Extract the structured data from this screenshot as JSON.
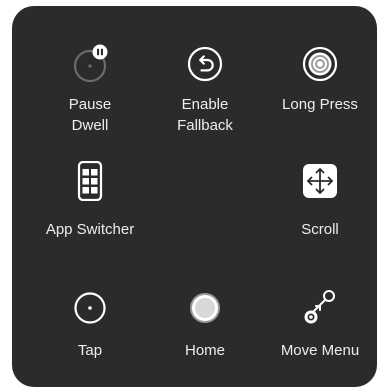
{
  "menu": {
    "items": {
      "pause_dwell": {
        "line1": "Pause",
        "line2": "Dwell"
      },
      "enable_fallback": {
        "line1": "Enable",
        "line2": "Fallback"
      },
      "long_press": {
        "label": "Long Press"
      },
      "app_switcher": {
        "label": "App Switcher"
      },
      "scroll": {
        "label": "Scroll"
      },
      "tap": {
        "label": "Tap"
      },
      "home": {
        "label": "Home"
      },
      "move_menu": {
        "label": "Move Menu"
      }
    },
    "icons": {
      "pause_dwell": "dwell-timer-pause-icon",
      "enable_fallback": "back-arrow-circle-icon",
      "long_press": "concentric-circles-icon",
      "app_switcher": "app-switcher-grid-icon",
      "scroll": "move-arrows-icon",
      "tap": "tap-dot-icon",
      "home": "home-button-icon",
      "move_menu": "move-menu-icon"
    },
    "colors": {
      "panel_bg": "#2a2b2d",
      "text": "#ededed",
      "icon": "#ffffff",
      "dim_icon": "#6a6b6d"
    }
  }
}
